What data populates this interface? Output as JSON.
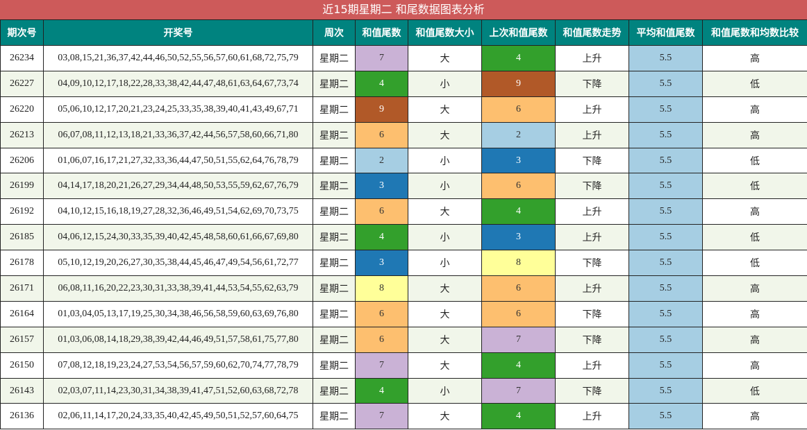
{
  "chart_data": {
    "type": "table",
    "title": "近15期星期二 和尾数据图表分析",
    "columns": [
      "期次号",
      "开奖号",
      "周次",
      "和值尾数",
      "和值尾数大小",
      "上次和值尾数",
      "和值尾数走势",
      "平均和值尾数",
      "和值尾数和均数比较"
    ],
    "rows": [
      {
        "issue": "26234",
        "numbers": "03,08,15,21,36,37,42,44,46,50,52,55,56,57,60,61,68,72,75,79",
        "weekday": "星期二",
        "tail": 7,
        "size": "大",
        "prev_tail": 4,
        "trend": "上升",
        "avg": "5.5",
        "compare": "高"
      },
      {
        "issue": "26227",
        "numbers": "04,09,10,12,17,18,22,28,33,38,42,44,47,48,61,63,64,67,73,74",
        "weekday": "星期二",
        "tail": 4,
        "size": "小",
        "prev_tail": 9,
        "trend": "下降",
        "avg": "5.5",
        "compare": "低"
      },
      {
        "issue": "26220",
        "numbers": "05,06,10,12,17,20,21,23,24,25,33,35,38,39,40,41,43,49,67,71",
        "weekday": "星期二",
        "tail": 9,
        "size": "大",
        "prev_tail": 6,
        "trend": "上升",
        "avg": "5.5",
        "compare": "高"
      },
      {
        "issue": "26213",
        "numbers": "06,07,08,11,12,13,18,21,33,36,37,42,44,56,57,58,60,66,71,80",
        "weekday": "星期二",
        "tail": 6,
        "size": "大",
        "prev_tail": 2,
        "trend": "上升",
        "avg": "5.5",
        "compare": "高"
      },
      {
        "issue": "26206",
        "numbers": "01,06,07,16,17,21,27,32,33,36,44,47,50,51,55,62,64,76,78,79",
        "weekday": "星期二",
        "tail": 2,
        "size": "小",
        "prev_tail": 3,
        "trend": "下降",
        "avg": "5.5",
        "compare": "低"
      },
      {
        "issue": "26199",
        "numbers": "04,14,17,18,20,21,26,27,29,34,44,48,50,53,55,59,62,67,76,79",
        "weekday": "星期二",
        "tail": 3,
        "size": "小",
        "prev_tail": 6,
        "trend": "下降",
        "avg": "5.5",
        "compare": "低"
      },
      {
        "issue": "26192",
        "numbers": "04,10,12,15,16,18,19,27,28,32,36,46,49,51,54,62,69,70,73,75",
        "weekday": "星期二",
        "tail": 6,
        "size": "大",
        "prev_tail": 4,
        "trend": "上升",
        "avg": "5.5",
        "compare": "高"
      },
      {
        "issue": "26185",
        "numbers": "04,06,12,15,24,30,33,35,39,40,42,45,48,58,60,61,66,67,69,80",
        "weekday": "星期二",
        "tail": 4,
        "size": "小",
        "prev_tail": 3,
        "trend": "上升",
        "avg": "5.5",
        "compare": "低"
      },
      {
        "issue": "26178",
        "numbers": "05,10,12,19,20,26,27,30,35,38,44,45,46,47,49,54,56,61,72,77",
        "weekday": "星期二",
        "tail": 3,
        "size": "小",
        "prev_tail": 8,
        "trend": "下降",
        "avg": "5.5",
        "compare": "低"
      },
      {
        "issue": "26171",
        "numbers": "06,08,11,16,20,22,23,30,31,33,38,39,41,44,53,54,55,62,63,79",
        "weekday": "星期二",
        "tail": 8,
        "size": "大",
        "prev_tail": 6,
        "trend": "上升",
        "avg": "5.5",
        "compare": "高"
      },
      {
        "issue": "26164",
        "numbers": "01,03,04,05,13,17,19,25,30,34,38,46,56,58,59,60,63,69,76,80",
        "weekday": "星期二",
        "tail": 6,
        "size": "大",
        "prev_tail": 6,
        "trend": "下降",
        "avg": "5.5",
        "compare": "高"
      },
      {
        "issue": "26157",
        "numbers": "01,03,06,08,14,18,29,38,39,42,44,46,49,51,57,58,61,75,77,80",
        "weekday": "星期二",
        "tail": 6,
        "size": "大",
        "prev_tail": 7,
        "trend": "下降",
        "avg": "5.5",
        "compare": "高"
      },
      {
        "issue": "26150",
        "numbers": "07,08,12,18,19,23,24,27,53,54,56,57,59,60,62,70,74,77,78,79",
        "weekday": "星期二",
        "tail": 7,
        "size": "大",
        "prev_tail": 4,
        "trend": "上升",
        "avg": "5.5",
        "compare": "高"
      },
      {
        "issue": "26143",
        "numbers": "02,03,07,11,14,23,30,31,34,38,39,41,47,51,52,60,63,68,72,78",
        "weekday": "星期二",
        "tail": 4,
        "size": "小",
        "prev_tail": 7,
        "trend": "下降",
        "avg": "5.5",
        "compare": "低"
      },
      {
        "issue": "26136",
        "numbers": "02,06,11,14,17,20,24,33,35,40,42,45,49,50,51,52,57,60,64,75",
        "weekday": "星期二",
        "tail": 7,
        "size": "大",
        "prev_tail": 4,
        "trend": "上升",
        "avg": "5.5",
        "compare": "高"
      }
    ],
    "tail_colors": {
      "2": "#a6cee3",
      "3": "#1f78b4",
      "4": "#33a02c",
      "6": "#fdbf6f",
      "7": "#cab2d6",
      "8": "#ffff99",
      "9": "#b15928"
    },
    "colors": {
      "title_bg": "#cd5a5a",
      "header_bg": "#00837f",
      "avg_bg": "#a6cee3",
      "row_alt_bg": "#f1f6ea"
    }
  }
}
